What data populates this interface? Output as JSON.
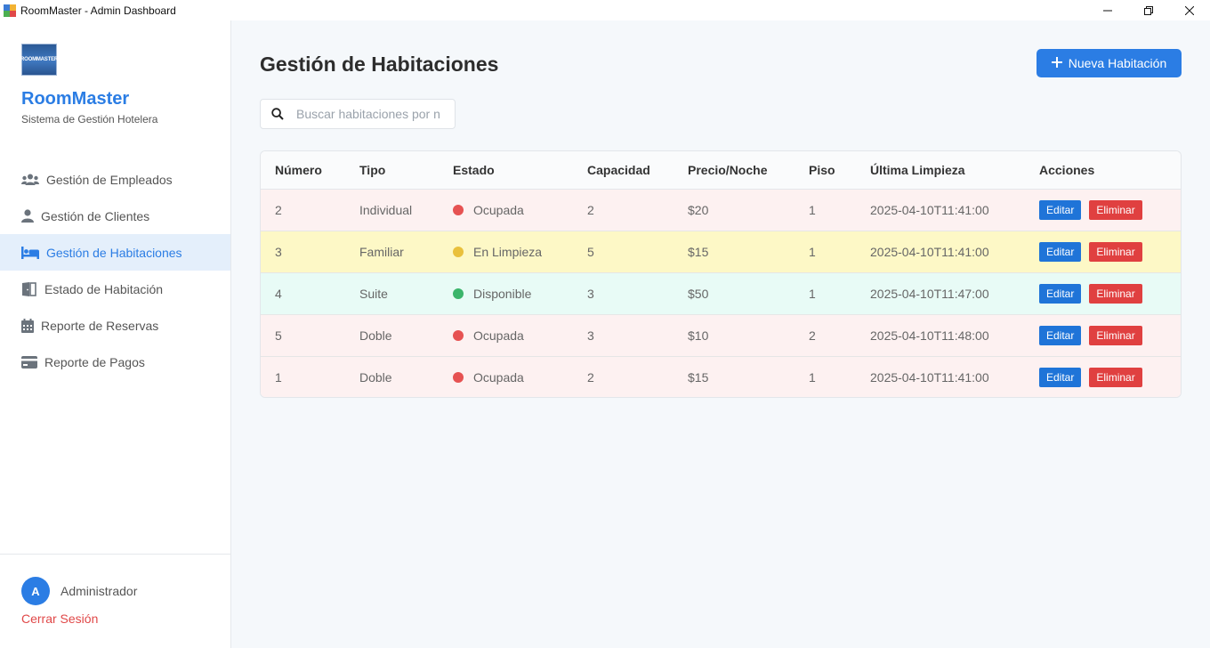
{
  "window": {
    "title": "RoomMaster - Admin Dashboard",
    "controls": {
      "minimize": "—",
      "maximize": "❐",
      "close": "✕"
    }
  },
  "sidebar": {
    "logo_text": "ROOMMASTER",
    "brand": "RoomMaster",
    "subtitle": "Sistema de Gestión Hotelera",
    "items": [
      {
        "label": "Gestión de Empleados",
        "icon": "users-icon",
        "active": false
      },
      {
        "label": "Gestión de Clientes",
        "icon": "user-icon",
        "active": false
      },
      {
        "label": "Gestión de Habitaciones",
        "icon": "bed-icon",
        "active": true
      },
      {
        "label": "Estado de Habitación",
        "icon": "door-icon",
        "active": false
      },
      {
        "label": "Reporte de Reservas",
        "icon": "calendar-icon",
        "active": false
      },
      {
        "label": "Reporte de Pagos",
        "icon": "credit-card-icon",
        "active": false
      }
    ],
    "user": {
      "initial": "A",
      "name": "Administrador",
      "logout": "Cerrar Sesión"
    }
  },
  "main": {
    "title": "Gestión de Habitaciones",
    "new_button": "Nueva Habitación",
    "search_placeholder": "Buscar habitaciones por n",
    "columns": [
      "Número",
      "Tipo",
      "Estado",
      "Capacidad",
      "Precio/Noche",
      "Piso",
      "Última Limpieza",
      "Acciones"
    ],
    "edit_label": "Editar",
    "delete_label": "Eliminar",
    "rows": [
      {
        "numero": "2",
        "tipo": "Individual",
        "estado": "Ocupada",
        "capacidad": "2",
        "precio": "$20",
        "piso": "1",
        "limpieza": "2025-04-10T11:41:00",
        "row_color": "#fdf1f1",
        "dot_color": "#e65252"
      },
      {
        "numero": "3",
        "tipo": "Familiar",
        "estado": "En Limpieza",
        "capacidad": "5",
        "precio": "$15",
        "piso": "1",
        "limpieza": "2025-04-10T11:41:00",
        "row_color": "#fdf8c6",
        "dot_color": "#e9c03c"
      },
      {
        "numero": "4",
        "tipo": "Suite",
        "estado": "Disponible",
        "capacidad": "3",
        "precio": "$50",
        "piso": "1",
        "limpieza": "2025-04-10T11:47:00",
        "row_color": "#e8fbf6",
        "dot_color": "#3bb56b"
      },
      {
        "numero": "5",
        "tipo": "Doble",
        "estado": "Ocupada",
        "capacidad": "3",
        "precio": "$10",
        "piso": "2",
        "limpieza": "2025-04-10T11:48:00",
        "row_color": "#fdf1f1",
        "dot_color": "#e65252"
      },
      {
        "numero": "1",
        "tipo": "Doble",
        "estado": "Ocupada",
        "capacidad": "2",
        "precio": "$15",
        "piso": "1",
        "limpieza": "2025-04-10T11:41:00",
        "row_color": "#fdf1f1",
        "dot_color": "#e65252"
      }
    ]
  },
  "colors": {
    "accent": "#2b7de4",
    "danger": "#e04040",
    "edit": "#1f74d8"
  }
}
